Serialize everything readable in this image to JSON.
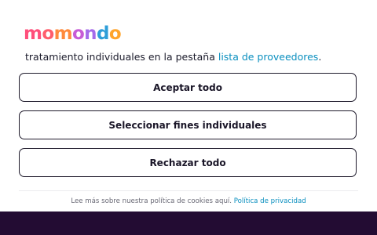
{
  "brand": {
    "logo_letters": [
      {
        "char": "m",
        "color": "#ff4f7b"
      },
      {
        "char": "o",
        "color": "#ff5d6c"
      },
      {
        "char": "m",
        "color": "#ff8a3c"
      },
      {
        "char": "o",
        "color": "#c75cd6"
      },
      {
        "char": "n",
        "color": "#a46cea"
      },
      {
        "char": "d",
        "color": "#2e9ed8"
      },
      {
        "char": "o",
        "color": "#ffa42b"
      }
    ]
  },
  "consent": {
    "intro_text": "tratamiento individuales en la pestaña ",
    "providers_link": "lista de proveedores",
    "intro_suffix": ".",
    "accept_all_label": "Aceptar todo",
    "select_purposes_label": "Seleccionar fines individuales",
    "reject_all_label": "Rechazar todo",
    "footer_text": "Lee más sobre nuestra política de cookies aquí. ",
    "privacy_link": "Política de privacidad"
  },
  "colors": {
    "link": "#0a8fbf",
    "button_border": "#1e1a2b",
    "bottom_bar": "#230c33"
  }
}
